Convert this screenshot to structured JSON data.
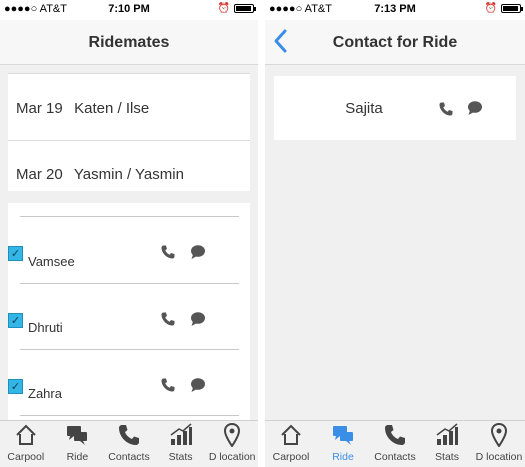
{
  "left_screen": {
    "status": {
      "carrier": "●●●●○ AT&T",
      "time": "7:10 PM"
    },
    "title": "Ridemates",
    "rides": [
      {
        "date": "Mar 19",
        "names": "Katen / Ilse"
      },
      {
        "date": "Mar 20",
        "names": "Yasmin / Yasmin"
      }
    ],
    "ridemates": [
      {
        "name": "Vamsee",
        "checked": true
      },
      {
        "name": "Dhruti",
        "checked": true
      },
      {
        "name": "Zahra",
        "checked": true
      }
    ],
    "tabs": [
      "Carpool",
      "Ride",
      "Contacts",
      "Stats",
      "D location"
    ],
    "active_tab": "Carpool"
  },
  "right_screen": {
    "status": {
      "carrier": "●●●●○ AT&T",
      "time": "7:13 PM"
    },
    "title": "Contact for Ride",
    "contacts": [
      {
        "name": "Sajita"
      }
    ],
    "tabs": [
      "Carpool",
      "Ride",
      "Contacts",
      "Stats",
      "D location"
    ],
    "active_tab": "Ride"
  },
  "colors": {
    "accent": "#3a8ee6",
    "checkbox": "#33b5e5",
    "background": "#f0f0f0"
  },
  "icons": [
    "phone-icon",
    "chat-icon",
    "home-icon",
    "ride-chat-icon",
    "contacts-phone-icon",
    "stats-icon",
    "location-pin-icon",
    "back-chevron-icon"
  ]
}
